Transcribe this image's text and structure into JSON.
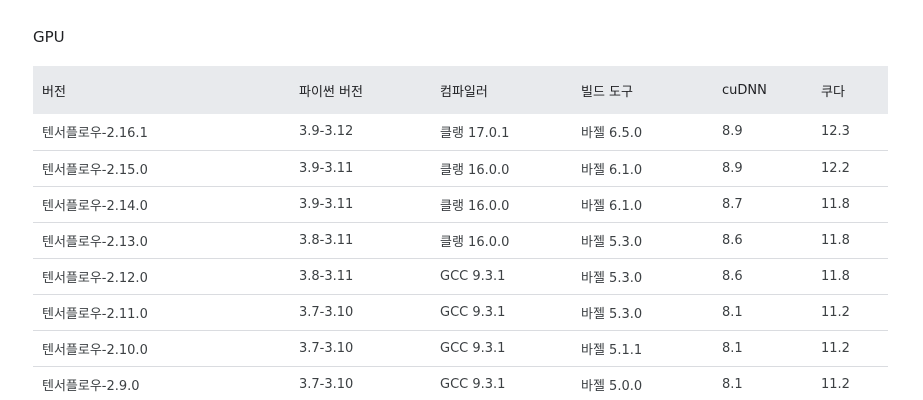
{
  "section": {
    "heading": "GPU"
  },
  "table": {
    "headers": [
      "버전",
      "파이썬 버전",
      "컴파일러",
      "빌드 도구",
      "cuDNN",
      "쿠다"
    ],
    "rows": [
      [
        "텐서플로우-2.16.1",
        "3.9-3.12",
        "클랭 17.0.1",
        "바젤 6.5.0",
        "8.9",
        "12.3"
      ],
      [
        "텐서플로우-2.15.0",
        "3.9-3.11",
        "클랭 16.0.0",
        "바젤 6.1.0",
        "8.9",
        "12.2"
      ],
      [
        "텐서플로우-2.14.0",
        "3.9-3.11",
        "클랭 16.0.0",
        "바젤 6.1.0",
        "8.7",
        "11.8"
      ],
      [
        "텐서플로우-2.13.0",
        "3.8-3.11",
        "클랭 16.0.0",
        "바젤 5.3.0",
        "8.6",
        "11.8"
      ],
      [
        "텐서플로우-2.12.0",
        "3.8-3.11",
        "GCC 9.3.1",
        "바젤 5.3.0",
        "8.6",
        "11.8"
      ],
      [
        "텐서플로우-2.11.0",
        "3.7-3.10",
        "GCC 9.3.1",
        "바젤 5.3.0",
        "8.1",
        "11.2"
      ],
      [
        "텐서플로우-2.10.0",
        "3.7-3.10",
        "GCC 9.3.1",
        "바젤 5.1.1",
        "8.1",
        "11.2"
      ],
      [
        "텐서플로우-2.9.0",
        "3.7-3.10",
        "GCC 9.3.1",
        "바젤 5.0.0",
        "8.1",
        "11.2"
      ]
    ]
  }
}
